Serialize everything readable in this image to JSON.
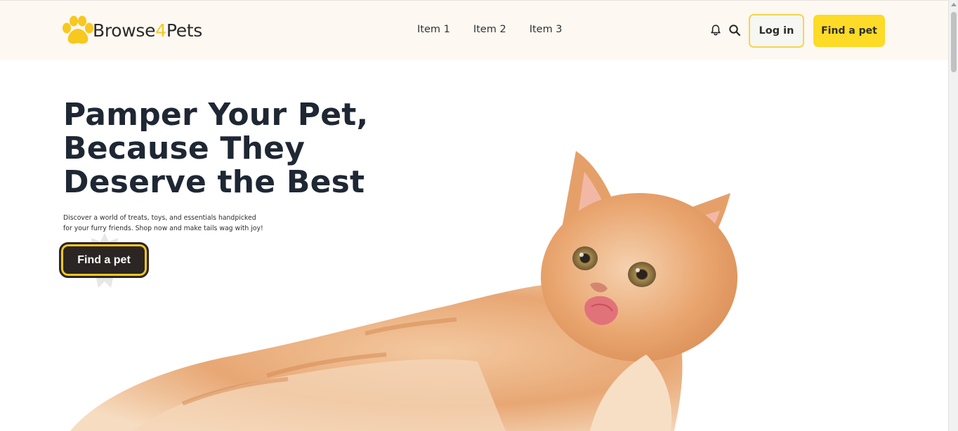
{
  "header": {
    "brand_prefix": "Browse",
    "brand_number": "4",
    "brand_suffix": "Pets",
    "nav": [
      {
        "label": "Item 1"
      },
      {
        "label": "Item 2"
      },
      {
        "label": "Item 3"
      }
    ],
    "login_label": "Log in",
    "find_pet_label": "Find a pet",
    "icons": [
      "paw-icon",
      "bell-icon",
      "search-icon"
    ]
  },
  "hero": {
    "title": "Pamper Your Pet, Because They Deserve the Best",
    "subtitle": "Discover a world of treats, toys, and essentials handpicked for your furry friends. Shop now and make tails wag with joy!",
    "cta_label": "Find a pet",
    "image_subject": "kitten"
  },
  "colors": {
    "accent_yellow": "#fddb26",
    "header_bg": "#fdf8f1",
    "dark_button": "#2b2524",
    "title_text": "#1e2733"
  }
}
